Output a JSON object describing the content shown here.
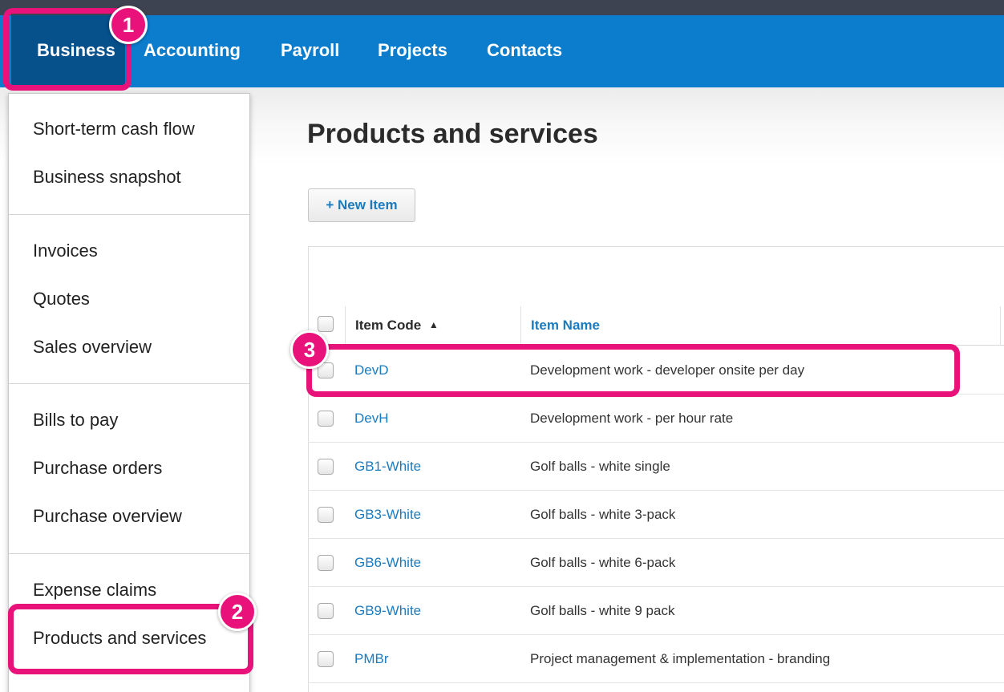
{
  "nav": {
    "items": [
      {
        "label": "Business"
      },
      {
        "label": "Accounting"
      },
      {
        "label": "Payroll"
      },
      {
        "label": "Projects"
      },
      {
        "label": "Contacts"
      }
    ]
  },
  "page": {
    "title": "Products and services",
    "new_item_label": "+ New Item"
  },
  "table": {
    "headers": {
      "item_code": "Item Code",
      "sort_indicator": "▲",
      "item_name": "Item Name"
    },
    "rows": [
      {
        "code": "DevD",
        "name": "Development work - developer onsite per day"
      },
      {
        "code": "DevH",
        "name": "Development work - per hour rate"
      },
      {
        "code": "GB1-White",
        "name": "Golf balls - white single"
      },
      {
        "code": "GB3-White",
        "name": "Golf balls - white 3-pack"
      },
      {
        "code": "GB6-White",
        "name": "Golf balls - white 6-pack"
      },
      {
        "code": "GB9-White",
        "name": "Golf balls - white 9 pack"
      },
      {
        "code": "PMBr",
        "name": "Project management & implementation - branding"
      }
    ]
  },
  "menu": {
    "groups": [
      [
        "Short-term cash flow",
        "Business snapshot"
      ],
      [
        "Invoices",
        "Quotes",
        "Sales overview"
      ],
      [
        "Bills to pay",
        "Purchase orders",
        "Purchase overview"
      ],
      [
        "Expense claims",
        "Products and services"
      ]
    ]
  },
  "annotations": {
    "step1": "1",
    "step2": "2",
    "step3": "3",
    "color": "#e8127a"
  },
  "colors": {
    "nav_bg": "#0c7ccc",
    "nav_active": "#06508c",
    "link": "#1a7bbf"
  }
}
